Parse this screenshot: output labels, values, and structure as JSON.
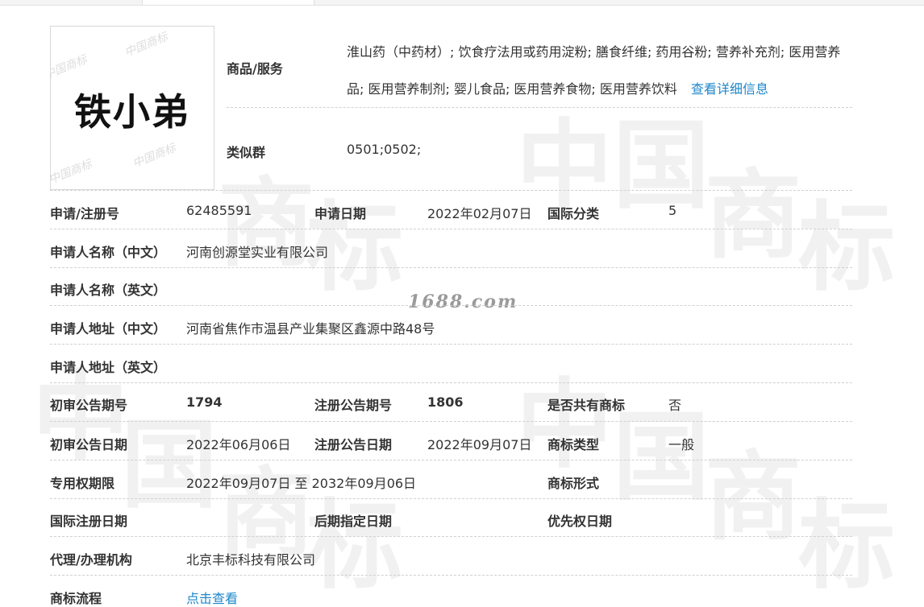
{
  "watermark": {
    "chars": [
      "中",
      "国",
      "商",
      "标"
    ],
    "site": "1688.com"
  },
  "logo": {
    "text": "铁小弟",
    "watermark_text": "中国商标"
  },
  "goods": {
    "label": "商品/服务",
    "text": "淮山药（中药材）; 饮食疗法用或药用淀粉; 膳食纤维; 药用谷粉; 营养补充剂; 医用营养品; 医用营养制剂; 婴儿食品; 医用营养食物; 医用营养饮料",
    "link": "查看详细信息"
  },
  "similar": {
    "label": "类似群",
    "value": "0501;0502;"
  },
  "fields": {
    "app_no_label": "申请/注册号",
    "app_no": "62485591",
    "app_date_label": "申请日期",
    "app_date": "2022年02月07日",
    "intl_class_label": "国际分类",
    "intl_class": "5",
    "applicant_cn_label": "申请人名称（中文）",
    "applicant_cn": "河南创源堂实业有限公司",
    "applicant_en_label": "申请人名称（英文）",
    "applicant_en": "",
    "address_cn_label": "申请人地址（中文）",
    "address_cn": "河南省焦作市温县产业集聚区鑫源中路48号",
    "address_en_label": "申请人地址（英文）",
    "address_en": "",
    "prelim_no_label": "初审公告期号",
    "prelim_no": "1794",
    "reg_no_label": "注册公告期号",
    "reg_no": "1806",
    "shared_label": "是否共有商标",
    "shared": "否",
    "prelim_date_label": "初审公告日期",
    "prelim_date": "2022年06月06日",
    "reg_date_label": "注册公告日期",
    "reg_date": "2022年09月07日",
    "tm_type_label": "商标类型",
    "tm_type": "一般",
    "term_label": "专用权期限",
    "term": "2022年09月07日 至 2032年09月06日",
    "tm_form_label": "商标形式",
    "tm_form": "",
    "intl_reg_date_label": "国际注册日期",
    "intl_reg_date": "",
    "later_date_label": "后期指定日期",
    "later_date": "",
    "priority_label": "优先权日期",
    "priority": "",
    "agent_label": "代理/办理机构",
    "agent": "北京丰标科技有限公司",
    "process_label": "商标流程",
    "process_link": "点击查看"
  }
}
